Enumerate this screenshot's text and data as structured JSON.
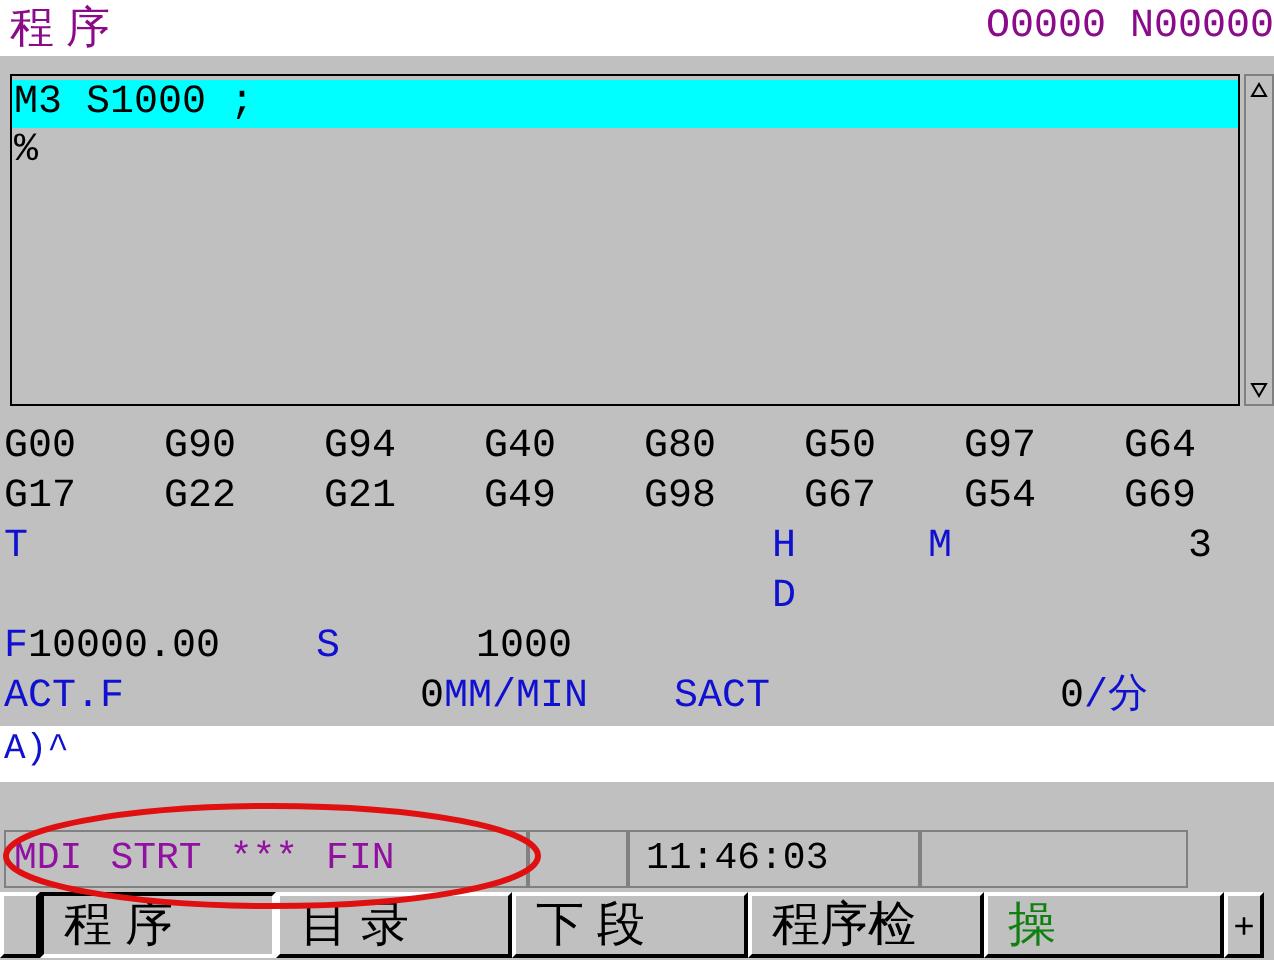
{
  "header": {
    "title": "程 序",
    "program_number": "O0000 N00000"
  },
  "program": {
    "lines": [
      {
        "text": "M3 S1000 ;",
        "selected": true
      },
      {
        "text": "%",
        "selected": false
      }
    ]
  },
  "modal_codes": [
    [
      "G00",
      "G90",
      "G94",
      "G40",
      "G80",
      "G50",
      "G97",
      "G64"
    ],
    [
      "G17",
      "G22",
      "G21",
      "G49",
      "G98",
      "G67",
      "G54",
      "G69"
    ]
  ],
  "tool_info": {
    "t_label": "T",
    "h_label": "H",
    "m_label": "M",
    "m_value": "3",
    "d_label": "D"
  },
  "feed": {
    "f_label": "F",
    "f_value": "10000.00",
    "s_label": "S",
    "s_value": "1000"
  },
  "actual": {
    "act_label": "ACT.F",
    "act_value": "0",
    "act_unit": "MM/MIN",
    "sact_label": "SACT",
    "sact_value": "0",
    "sact_unit": "/分"
  },
  "input_line": "A)^",
  "status_bar": {
    "segments": [
      "MDI",
      "STRT",
      "***",
      "FIN"
    ],
    "time": "11:46:03"
  },
  "softkeys": [
    {
      "label": "程 序",
      "selected": true
    },
    {
      "label": "目 录",
      "selected": false
    },
    {
      "label": "下 段",
      "selected": false
    },
    {
      "label": "程序检",
      "selected": false
    },
    {
      "label": "操",
      "selected": false
    }
  ],
  "next_key": "+"
}
